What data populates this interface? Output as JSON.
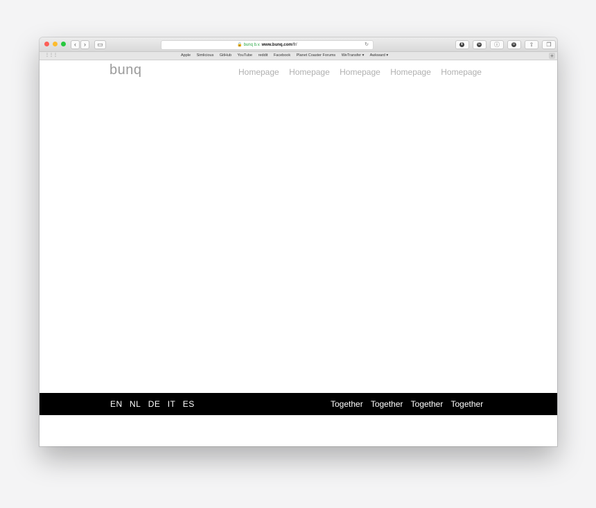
{
  "browser": {
    "address": {
      "secure_label": "bunq b.v.",
      "domain": "www.bunq.com",
      "path": "/fr/"
    },
    "back_glyph": "‹",
    "forward_glyph": "›",
    "sidebar_glyph": "▭",
    "reload_glyph": "↻",
    "bookmarks": [
      "Apple",
      "Simlicious",
      "GitHub",
      "YouTube",
      "reddit",
      "Facebook",
      "Planet Coaster Forums",
      "WeTransfer ▾",
      "Awkward ▾"
    ],
    "toolbar_icons": [
      "extension-icon",
      "grammarly-icon",
      "info-icon",
      "adblock-icon",
      "share-icon",
      "tabs-icon"
    ],
    "add_glyph": "+"
  },
  "page": {
    "logo": "bunq",
    "nav": [
      "Homepage",
      "Homepage",
      "Homepage",
      "Homepage",
      "Homepage"
    ],
    "footer": {
      "languages": [
        "EN",
        "NL",
        "DE",
        "IT",
        "ES"
      ],
      "links": [
        "Together",
        "Together",
        "Together",
        "Together"
      ]
    }
  }
}
